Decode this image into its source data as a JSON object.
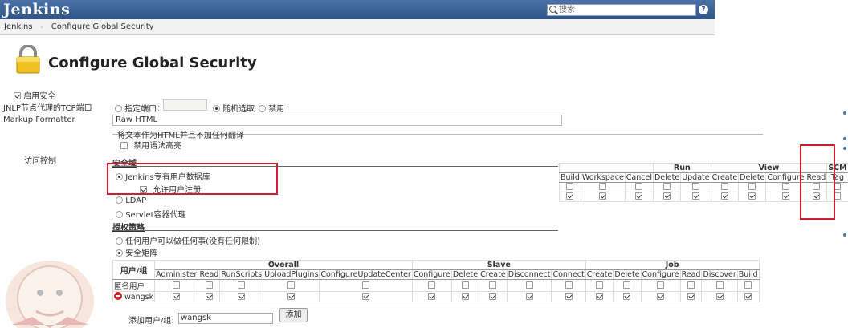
{
  "header": {
    "logo": "Jenkins",
    "search_placeholder": "搜索",
    "help": "?"
  },
  "breadcrumb": [
    "Jenkins",
    "Configure Global Security"
  ],
  "page_title": "Configure Global Security",
  "form": {
    "enable_security": "启用安全",
    "jnlp_label": "JNLP节点代理的TCP端口",
    "jnlp_fixed": "指定端口：",
    "jnlp_random": "随机选取",
    "jnlp_disable": "禁用",
    "markup_label": "Markup Formatter",
    "markup_value": "Raw HTML",
    "markup_desc": "将文本作为HTML并且不加任何翻译",
    "disable_syntax": "禁用语法高亮",
    "access_label": "访问控制",
    "security_realm": "安全域",
    "realm_jenkins": "Jenkins专有用户数据库",
    "allow_signup": "允许用户注册",
    "realm_ldap": "LDAP",
    "realm_servlet": "Servlet容器代理",
    "authz": "授权策略",
    "authz_anyone": "任何用户可以做任何事(没有任何限制)",
    "authz_matrix": "安全矩阵",
    "add_label": "添加用户/组:",
    "add_value": "wangsk",
    "add_button": "添加"
  },
  "matrix": {
    "user_header": "用户/组",
    "groups": [
      {
        "name": "Overall",
        "cols": [
          "Administer",
          "Read",
          "RunScripts",
          "UploadPlugins",
          "ConfigureUpdateCenter"
        ]
      },
      {
        "name": "Slave",
        "cols": [
          "Configure",
          "Delete",
          "Create",
          "Disconnect",
          "Connect"
        ]
      },
      {
        "name": "Job",
        "cols": [
          "Create",
          "Delete",
          "Configure",
          "Read",
          "Discover",
          "Build"
        ]
      }
    ],
    "rows": [
      {
        "user": "匿名用户",
        "checks": [
          0,
          0,
          0,
          0,
          0,
          0,
          0,
          0,
          0,
          0,
          0,
          0,
          0,
          0,
          0,
          0
        ]
      },
      {
        "user": "wangsk",
        "checks": [
          1,
          1,
          1,
          1,
          1,
          1,
          1,
          1,
          1,
          1,
          1,
          1,
          1,
          1,
          1,
          1
        ]
      }
    ]
  },
  "matrix_right": {
    "groups": [
      {
        "name": "",
        "cols": [
          "Build",
          "Workspace",
          "Cancel"
        ]
      },
      {
        "name": "Run",
        "cols": [
          "Delete",
          "Update"
        ]
      },
      {
        "name": "View",
        "cols": [
          "Create",
          "Delete",
          "Configure",
          "Read"
        ]
      },
      {
        "name": "SCM",
        "cols": [
          "Tag"
        ]
      }
    ],
    "rows": [
      {
        "checks": [
          0,
          0,
          0,
          0,
          0,
          0,
          0,
          0,
          0,
          0
        ]
      },
      {
        "checks": [
          1,
          1,
          1,
          1,
          1,
          1,
          1,
          1,
          1,
          0
        ]
      }
    ]
  }
}
